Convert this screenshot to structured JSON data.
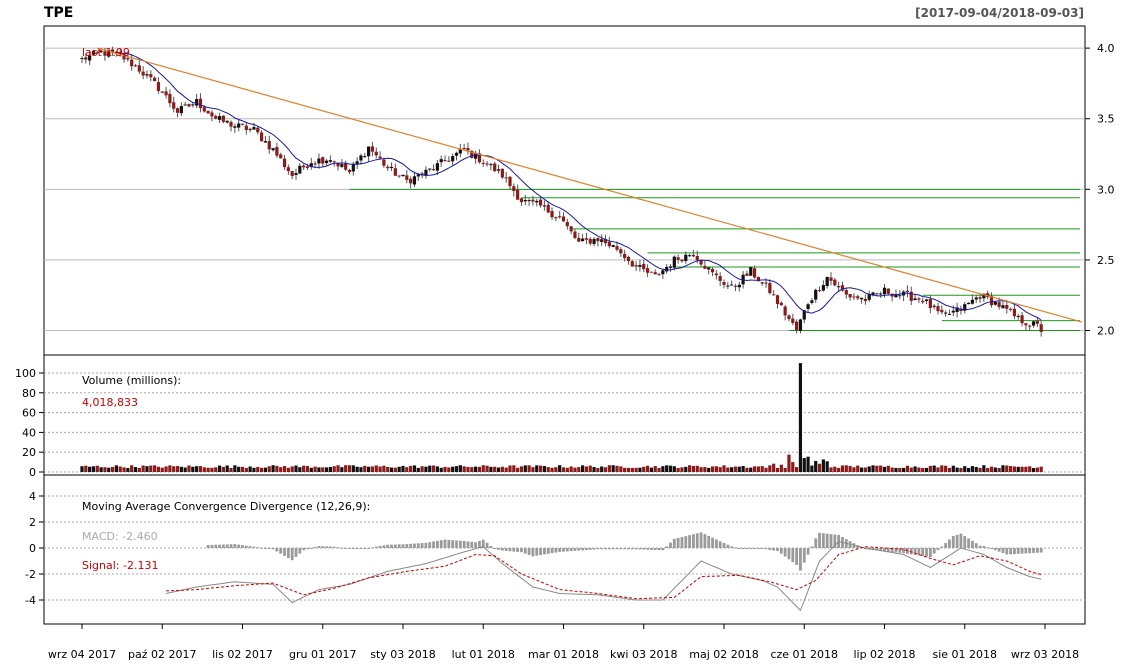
{
  "title": "TPE",
  "date_range": "[2017-09-04/2018-09-03]",
  "colors": {
    "up": "#111111",
    "down": "#8b1a1a",
    "ma": "#1a1aa8",
    "trend": "#e0802a",
    "support": "#1a9a1a",
    "grid": "#bbbbbb",
    "macd_hist": "#9a9a9a",
    "macd_line": "#888888",
    "signal": "#cc0000"
  },
  "panels": {
    "price": {
      "ticks": [
        "2.0",
        "2.5",
        "3.0",
        "3.5",
        "4.0"
      ],
      "overlay_label": "last 1.99"
    },
    "volume": {
      "label": "Volume (millions):",
      "value": "4,018,833",
      "ticks": [
        "0",
        "20",
        "40",
        "60",
        "80",
        "100"
      ]
    },
    "macd": {
      "label": "Moving Average Convergence Divergence (12,26,9):",
      "macd_text": "MACD: -2.460",
      "signal_text": "Signal: -2.131",
      "ticks": [
        "-4",
        "-2",
        "0",
        "2",
        "4"
      ]
    }
  },
  "x_labels": [
    "wrz 04 2017",
    "paź 02 2017",
    "lis 02 2017",
    "gru 01 2017",
    "sty 03 2018",
    "lut 01 2018",
    "mar 01 2018",
    "kwi 03 2018",
    "maj 02 2018",
    "cze 01 2018",
    "lip 02 2018",
    "sie 01 2018",
    "wrz 03 2018"
  ],
  "chart_data": {
    "type": "candlestick",
    "x_range": [
      "2017-09-04",
      "2018-09-03"
    ],
    "price": {
      "ylim": [
        1.94,
        4.1
      ],
      "trading_days": 252,
      "close_anchors": [
        [
          0,
          3.92
        ],
        [
          5,
          3.97
        ],
        [
          10,
          3.95
        ],
        [
          15,
          3.85
        ],
        [
          20,
          3.72
        ],
        [
          25,
          3.55
        ],
        [
          30,
          3.62
        ],
        [
          35,
          3.5
        ],
        [
          40,
          3.45
        ],
        [
          45,
          3.42
        ],
        [
          50,
          3.28
        ],
        [
          55,
          3.1
        ],
        [
          60,
          3.2
        ],
        [
          65,
          3.22
        ],
        [
          70,
          3.12
        ],
        [
          75,
          3.3
        ],
        [
          80,
          3.15
        ],
        [
          85,
          3.06
        ],
        [
          90,
          3.12
        ],
        [
          95,
          3.2
        ],
        [
          100,
          3.28
        ],
        [
          105,
          3.2
        ],
        [
          110,
          3.1
        ],
        [
          115,
          2.92
        ],
        [
          120,
          2.88
        ],
        [
          125,
          2.8
        ],
        [
          130,
          2.62
        ],
        [
          135,
          2.65
        ],
        [
          140,
          2.58
        ],
        [
          145,
          2.45
        ],
        [
          150,
          2.38
        ],
        [
          155,
          2.5
        ],
        [
          160,
          2.55
        ],
        [
          165,
          2.4
        ],
        [
          170,
          2.3
        ],
        [
          175,
          2.42
        ],
        [
          180,
          2.28
        ],
        [
          185,
          2.08
        ],
        [
          187,
          2.0
        ],
        [
          190,
          2.2
        ],
        [
          195,
          2.38
        ],
        [
          200,
          2.25
        ],
        [
          205,
          2.22
        ],
        [
          210,
          2.28
        ],
        [
          215,
          2.25
        ],
        [
          220,
          2.22
        ],
        [
          225,
          2.1
        ],
        [
          230,
          2.15
        ],
        [
          235,
          2.25
        ],
        [
          240,
          2.18
        ],
        [
          245,
          2.08
        ],
        [
          250,
          2.03
        ],
        [
          252,
          1.99
        ]
      ],
      "last": 1.99,
      "trendline": {
        "from": [
          "2017-09-08",
          4.0
        ],
        "to": [
          "2018-09-03",
          2.06
        ]
      },
      "support_levels": [
        2.0,
        2.07,
        2.25,
        2.45,
        2.55,
        2.72,
        2.94,
        3.0
      ]
    },
    "volume": {
      "ylim": [
        0,
        110
      ],
      "unit": "millions",
      "typical": 4,
      "spike": {
        "day": 188,
        "value": 110
      },
      "last": 4.018833
    },
    "macd": {
      "ylim": [
        -5.5,
        5
      ],
      "params": [
        12,
        26,
        9
      ],
      "macd_anchors": [
        [
          22,
          -3.5
        ],
        [
          30,
          -3.0
        ],
        [
          40,
          -2.6
        ],
        [
          50,
          -2.8
        ],
        [
          55,
          -4.2
        ],
        [
          62,
          -3.2
        ],
        [
          70,
          -2.8
        ],
        [
          80,
          -1.8
        ],
        [
          90,
          -1.2
        ],
        [
          100,
          -0.3
        ],
        [
          105,
          0.1
        ],
        [
          110,
          -1.2
        ],
        [
          118,
          -3.0
        ],
        [
          125,
          -3.5
        ],
        [
          135,
          -3.6
        ],
        [
          145,
          -4.0
        ],
        [
          152,
          -4.0
        ],
        [
          162,
          -1.0
        ],
        [
          170,
          -2.0
        ],
        [
          178,
          -2.5
        ],
        [
          182,
          -3.0
        ],
        [
          188,
          -4.8
        ],
        [
          193,
          -1.0
        ],
        [
          198,
          0.5
        ],
        [
          205,
          0.0
        ],
        [
          215,
          -0.5
        ],
        [
          222,
          -1.5
        ],
        [
          230,
          0.0
        ],
        [
          236,
          -0.5
        ],
        [
          242,
          -1.5
        ],
        [
          248,
          -2.2
        ],
        [
          252,
          -2.46
        ]
      ],
      "signal_anchors": [
        [
          22,
          -3.3
        ],
        [
          30,
          -3.2
        ],
        [
          40,
          -2.9
        ],
        [
          50,
          -2.7
        ],
        [
          58,
          -3.6
        ],
        [
          66,
          -3.1
        ],
        [
          75,
          -2.3
        ],
        [
          85,
          -1.8
        ],
        [
          95,
          -1.4
        ],
        [
          103,
          -0.5
        ],
        [
          108,
          -0.6
        ],
        [
          115,
          -2.0
        ],
        [
          125,
          -3.2
        ],
        [
          135,
          -3.5
        ],
        [
          145,
          -3.9
        ],
        [
          155,
          -3.8
        ],
        [
          162,
          -2.2
        ],
        [
          172,
          -2.1
        ],
        [
          180,
          -2.6
        ],
        [
          187,
          -3.2
        ],
        [
          192,
          -2.5
        ],
        [
          198,
          -0.5
        ],
        [
          205,
          0.1
        ],
        [
          215,
          -0.1
        ],
        [
          222,
          -0.8
        ],
        [
          228,
          -1.3
        ],
        [
          235,
          -0.6
        ],
        [
          242,
          -1.0
        ],
        [
          248,
          -1.8
        ],
        [
          252,
          -2.131
        ]
      ]
    }
  }
}
